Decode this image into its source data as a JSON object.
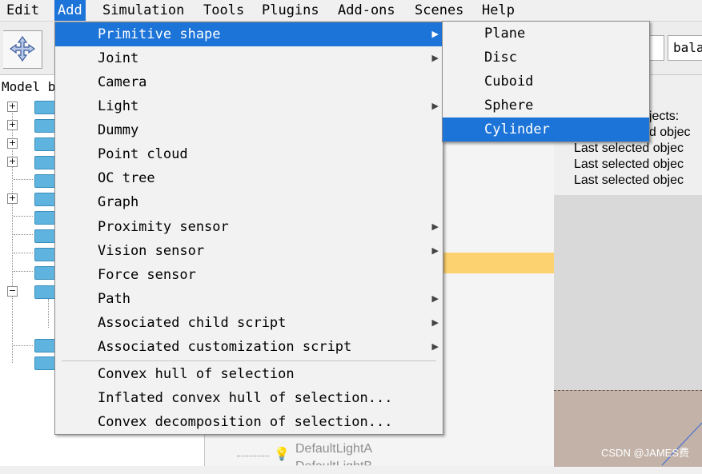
{
  "menubar": {
    "items": [
      {
        "label": "Edit"
      },
      {
        "label": "Add"
      },
      {
        "label": "Simulation"
      },
      {
        "label": "Tools"
      },
      {
        "label": "Plugins"
      },
      {
        "label": "Add-ons"
      },
      {
        "label": "Scenes"
      },
      {
        "label": "Help"
      }
    ],
    "active": "Add"
  },
  "toolbar": {
    "combo_text": "bala"
  },
  "model_browser": {
    "title": "Model b"
  },
  "add_menu": {
    "items": [
      {
        "label": "Primitive shape",
        "has_submenu": true,
        "highlighted": true
      },
      {
        "label": "Joint",
        "has_submenu": true
      },
      {
        "label": "Camera",
        "has_submenu": false
      },
      {
        "label": "Light",
        "has_submenu": true
      },
      {
        "label": "Dummy",
        "has_submenu": false
      },
      {
        "label": "Point cloud",
        "has_submenu": false
      },
      {
        "label": "OC tree",
        "has_submenu": false
      },
      {
        "label": "Graph",
        "has_submenu": false
      },
      {
        "label": "Proximity sensor",
        "has_submenu": true
      },
      {
        "label": "Vision sensor",
        "has_submenu": true
      },
      {
        "label": "Force sensor",
        "has_submenu": false
      },
      {
        "label": "Path",
        "has_submenu": true
      },
      {
        "label": "Associated child script",
        "has_submenu": true
      },
      {
        "label": "Associated customization script",
        "has_submenu": true
      },
      {
        "label": "Convex hull of selection",
        "has_submenu": false
      },
      {
        "label": "Inflated convex hull of selection...",
        "has_submenu": false
      },
      {
        "label": "Convex decomposition of selection...",
        "has_submenu": false
      }
    ]
  },
  "primitive_submenu": {
    "items": [
      {
        "label": "Plane"
      },
      {
        "label": "Disc"
      },
      {
        "label": "Cuboid"
      },
      {
        "label": "Sphere"
      },
      {
        "label": "Cylinder",
        "highlighted": true
      }
    ]
  },
  "hierarchy": {
    "items": [
      {
        "label": "DefaultLightA"
      },
      {
        "label": "DefaultLightB"
      }
    ]
  },
  "scene_info": {
    "lines": [
      "bjects:",
      "ed objec",
      "Last selected objec",
      "Last selected objec",
      "Last selected objec"
    ]
  },
  "watermark": "CSDN @JAMES费",
  "colors": {
    "highlight": "#1c73d8",
    "hierarchy_selection": "#fcd271",
    "floor": "#c2b2a8"
  }
}
